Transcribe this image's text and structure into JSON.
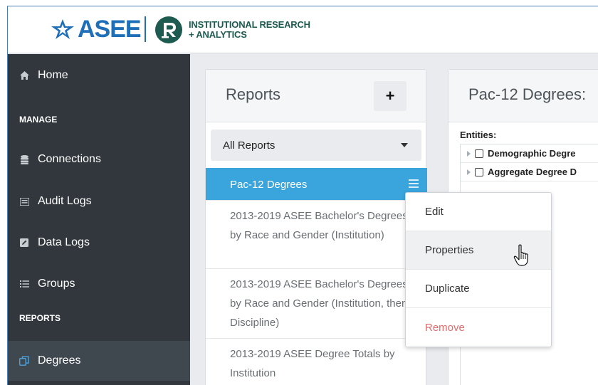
{
  "header": {
    "asee_logo_text": "ASEE",
    "ira_title_line1": "INSTITUTIONAL RESEARCH",
    "ira_title_line2": "+ ANALYTICS"
  },
  "sidebar": {
    "items": [
      {
        "label": "Home",
        "icon": "home-icon"
      },
      {
        "label": "Connections",
        "icon": "database-icon"
      },
      {
        "label": "Audit Logs",
        "icon": "list-icon"
      },
      {
        "label": "Data Logs",
        "icon": "edit-icon"
      },
      {
        "label": "Groups",
        "icon": "list-icon"
      },
      {
        "label": "Degrees",
        "icon": "copy-icon",
        "active": true
      }
    ],
    "sections": {
      "manage": "MANAGE",
      "reports": "REPORTS"
    }
  },
  "reports_panel": {
    "title": "Reports",
    "add_label": "+",
    "filter_value": "All Reports",
    "items": [
      {
        "label": "Pac-12 Degrees",
        "selected": true
      },
      {
        "label": "2013-2019 ASEE Bachelor's Degrees by Race and Gender (Institution)"
      },
      {
        "label": "2013-2019 ASEE Bachelor's Degrees by Race and Gender (Institution, then Discipline)"
      },
      {
        "label": "2013-2019 ASEE Degree Totals by Institution"
      }
    ]
  },
  "context_menu": {
    "items": [
      {
        "label": "Edit"
      },
      {
        "label": "Properties",
        "hover": true
      },
      {
        "label": "Duplicate"
      },
      {
        "label": "Remove",
        "danger": true
      }
    ]
  },
  "detail_panel": {
    "title": "Pac-12 Degrees:",
    "entities_label": "Entities:",
    "entities": [
      {
        "label": "Demographic Degre"
      },
      {
        "label": "Aggregate Degree D"
      }
    ]
  },
  "colors": {
    "accent": "#3aa4dd",
    "sidebar_bg": "#31373d",
    "brand_blue": "#1e6fb8",
    "brand_green": "#1d5a4f",
    "danger": "#e36b6b"
  }
}
